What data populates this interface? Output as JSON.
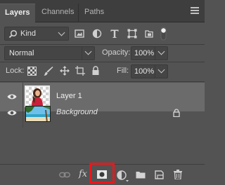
{
  "tabs": [
    {
      "label": "Layers",
      "active": true
    },
    {
      "label": "Channels",
      "active": false
    },
    {
      "label": "Paths",
      "active": false
    }
  ],
  "filter": {
    "kind_label": "Kind",
    "filter_icons": [
      "image-filter-icon",
      "adjustment-filter-icon",
      "type-filter-icon",
      "shape-filter-icon",
      "smart-object-filter-icon",
      "filter-toggle-icon"
    ]
  },
  "blend": {
    "mode": "Normal",
    "opacity_label": "Opacity:",
    "opacity_value": "100%"
  },
  "lock": {
    "label": "Lock:",
    "fill_label": "Fill:",
    "fill_value": "100%"
  },
  "layers": [
    {
      "name": "Layer 1",
      "selected": true,
      "visible": true,
      "locked": false
    },
    {
      "name": "Background",
      "selected": false,
      "visible": true,
      "locked": true
    }
  ],
  "bottom_tools": [
    "link-layers-icon",
    "fx-icon",
    "add-mask-icon",
    "adjustment-layer-icon",
    "new-group-icon",
    "new-layer-icon",
    "trash-icon"
  ],
  "fx_label": "fx",
  "colors": {
    "panel": "#535353",
    "selected_row": "#6b6b6b",
    "highlight": "#e8181c"
  }
}
